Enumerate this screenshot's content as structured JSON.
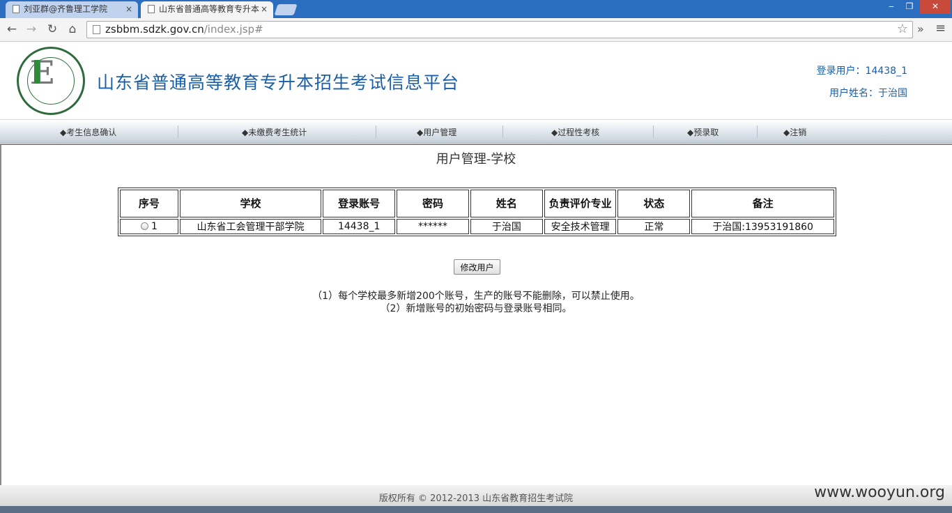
{
  "browser": {
    "tabs": [
      {
        "label": "刘亚群@齐鲁理工学院"
      },
      {
        "label": "山东省普通高等教育专升本"
      }
    ],
    "url_host": "zsbbm.sdzk.gov.cn",
    "url_path": "/index.jsp#",
    "icons": {
      "back": "←",
      "forward": "→",
      "reload": "↻",
      "home": "⌂",
      "star": "☆",
      "more": "»",
      "menu": "≡",
      "close": "×",
      "minimize": "‒",
      "restore": "❐",
      "window_close": "✕"
    }
  },
  "header": {
    "title": "山东省普通高等教育专升本招生考试信息平台",
    "login_user": "登录用户：14438_1",
    "user_name": "用户姓名：于治国"
  },
  "menu": [
    "◆考生信息确认",
    "◆未缴费考生统计",
    "◆用户管理",
    "◆过程性考核",
    "◆预录取",
    "◆注销"
  ],
  "main": {
    "title": "用户管理-学校",
    "table": {
      "headers": [
        "序号",
        "学校",
        "登录账号",
        "密码",
        "姓名",
        "负责评价专业",
        "状态",
        "备注"
      ],
      "rows": [
        [
          "1",
          "山东省工会管理干部学院",
          "14438_1",
          "******",
          "于治国",
          "安全技术管理",
          "正常",
          "于治国:13953191860"
        ]
      ]
    },
    "modify_button": "修改用户",
    "note1": "（1）每个学校最多新增200个账号，生产的账号不能删除，可以禁止使用。",
    "note2": "（2）新增账号的初始密码与登录账号相同。"
  },
  "footer": {
    "copyright": "版权所有 © 2012-2013 山东省教育招生考试院",
    "watermark": "www.wooyun.org"
  }
}
